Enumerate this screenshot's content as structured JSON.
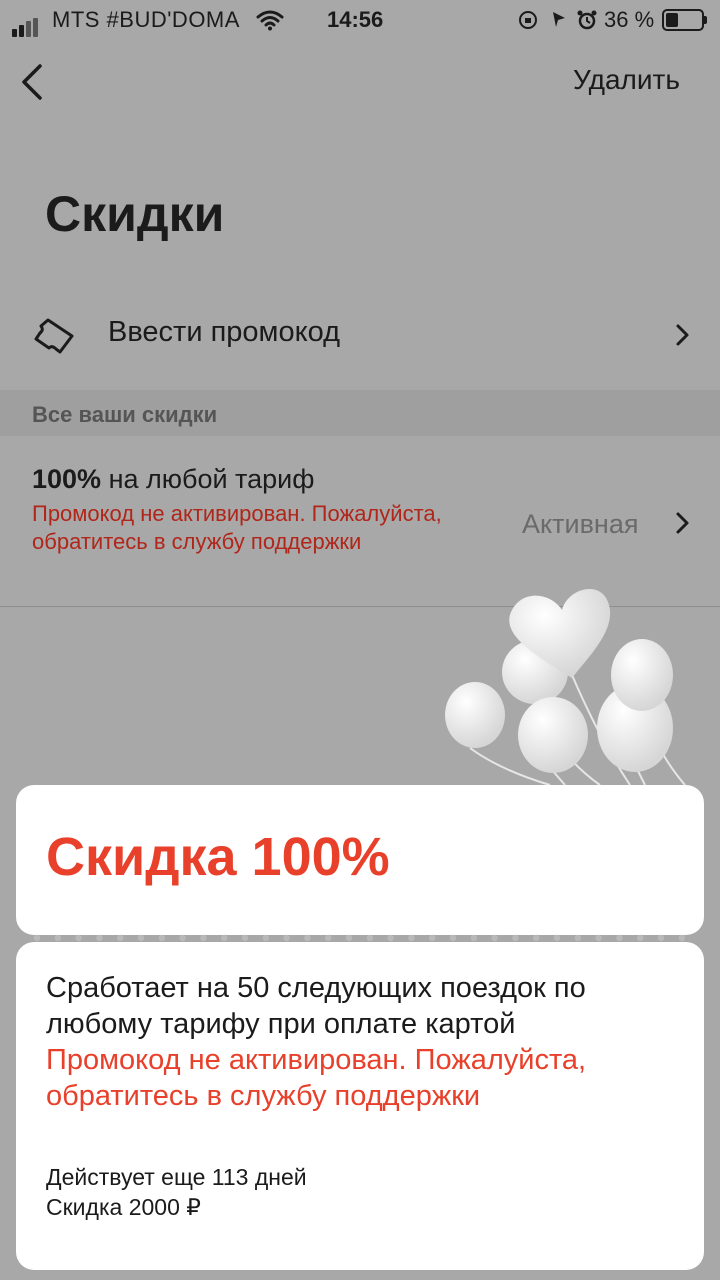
{
  "status_bar": {
    "carrier": "MTS #BUD'DOMA",
    "time": "14:56",
    "battery": "36 %",
    "battery_level": 0.36
  },
  "header": {
    "delete_label": "Удалить"
  },
  "page": {
    "title": "Скидки"
  },
  "promo": {
    "label": "Ввести промокод"
  },
  "section": {
    "label": "Все ваши скидки"
  },
  "discount_item": {
    "title_bold": "100%",
    "title_rest": " на любой тариф",
    "error": "Промокод не активирован. Пожалуйста, обратитесь в службу поддержки",
    "status": "Активная"
  },
  "card": {
    "title": "Скидка 100%",
    "description": "Сработает на 50 следующих поездок по любому тарифу при оплате картой",
    "error": "Промокод не активирован. Пожалуйста, обратитесь в службу поддержки",
    "validity": "Действует еще 113 дней",
    "amount": "Скидка 2000 ₽"
  },
  "colors": {
    "accent_red": "#e8402a",
    "error_dark_red": "#b0261a",
    "overlay_gray": "#a8a8a8"
  }
}
